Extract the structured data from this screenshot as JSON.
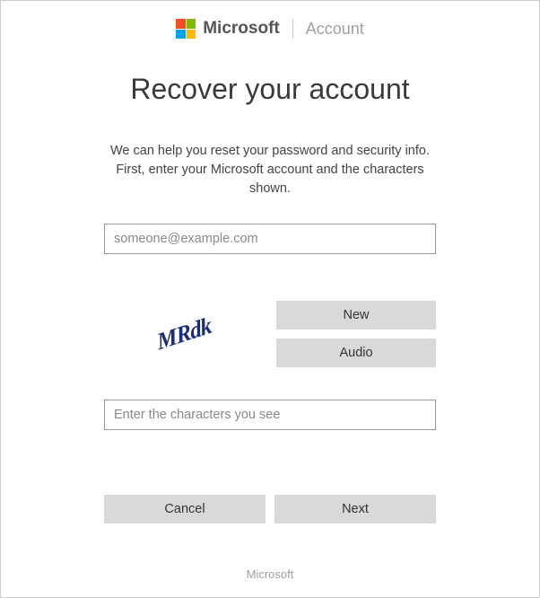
{
  "header": {
    "brand": "Microsoft",
    "section": "Account"
  },
  "title": "Recover your account",
  "instructions": "We can help you reset your password and security info. First, enter your Microsoft account and the characters shown.",
  "email": {
    "placeholder": "someone@example.com"
  },
  "captcha": {
    "text": "MRdk",
    "new_label": "New",
    "audio_label": "Audio",
    "input_placeholder": "Enter the characters you see"
  },
  "actions": {
    "cancel": "Cancel",
    "next": "Next"
  },
  "footer": "Microsoft"
}
